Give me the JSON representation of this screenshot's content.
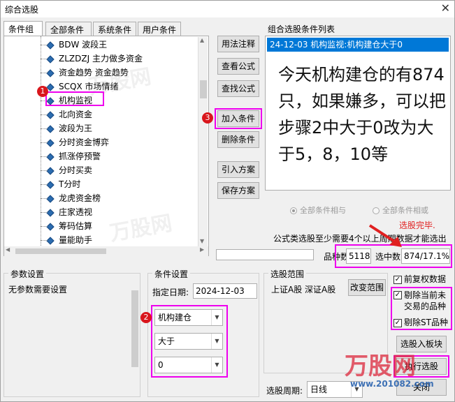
{
  "window": {
    "title": "综合选股"
  },
  "tabs": [
    "条件组",
    "全部条件",
    "系统条件",
    "用户条件"
  ],
  "tree_items": [
    "BDW 波段王",
    "ZLZDZJ 主力做多资金",
    "资金趋势 资金趋势",
    "SCQX 市场情绪",
    "机构监视",
    "北向资金",
    "波段为王",
    "分时资金博弈",
    "抓涨停预警",
    "分时买卖",
    "T分时",
    "龙虎资金榜",
    "庄家透视",
    "筹码估算",
    "量能助手"
  ],
  "buttons": {
    "usage": "用法注释",
    "view_formula": "查看公式",
    "find_formula": "查找公式",
    "add_condition": "加入条件",
    "delete_condition": "删除条件",
    "import_plan": "引入方案",
    "save_plan": "保存方案",
    "change_range": "改变范围",
    "to_block": "选股入板块",
    "execute": "执行选股",
    "close": "关闭"
  },
  "condition_list": {
    "label": "组合选股条件列表",
    "selected_item": "24-12-03 机构监视:机构建仓大于0",
    "annotation": "今天机构建仓的有874只，如果嫌多，可以把步骤2中大于0改为大于5，8，10等"
  },
  "logic": {
    "and_label": "全部条件相与",
    "or_label": "全部条件相或"
  },
  "status": {
    "done": "选股完毕.",
    "note": "公式类选股至少需要4个以上周期数据才能选出",
    "count_label": "品种数",
    "count_value": "5118",
    "selected_label": "选中数",
    "selected_value": "874/17.1%"
  },
  "params": {
    "title": "参数设置",
    "text": "无参数需要设置"
  },
  "cond_settings": {
    "title": "条件设置",
    "date_label": "指定日期:",
    "date_value": "2024-12-03",
    "combo1": "机构建仓",
    "combo2": "大于",
    "combo3": "0"
  },
  "range": {
    "title": "选股范围",
    "value": "上证A股 深证A股"
  },
  "options": {
    "rights": "前复权数据",
    "exclude_untraded": "剔除当前未交易的品种",
    "exclude_st": "剔除ST品种"
  },
  "period": {
    "label": "选股周期:",
    "value": "日线"
  },
  "badges": [
    "1",
    "2",
    "3"
  ],
  "watermark": {
    "text": "万股网",
    "url": "www.201082.com"
  },
  "colors": {
    "highlight": "#ee00ee",
    "selection": "#0078d7",
    "badge": "#d9161c",
    "status_red": "#e02020"
  }
}
